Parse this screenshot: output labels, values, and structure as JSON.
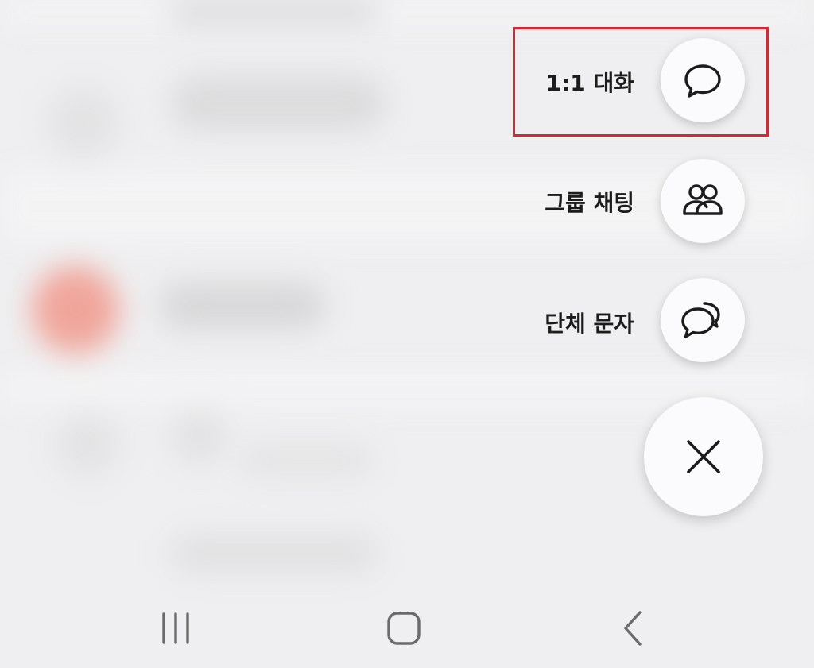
{
  "fab_menu": {
    "items": [
      {
        "label": "1:1 대화",
        "icon": "chat-bubble-icon"
      },
      {
        "label": "그룹 채팅",
        "icon": "people-icon"
      },
      {
        "label": "단체 문자",
        "icon": "chat-bubbles-icon"
      }
    ],
    "close_icon": "close-icon",
    "highlight_color": "#d9262f"
  },
  "navbar": {
    "recents_icon": "recents-icon",
    "home_icon": "home-icon",
    "back_icon": "back-icon"
  },
  "colors": {
    "background": "#efeff1",
    "fab_background": "#fbfbfd",
    "label_text": "#1c1c1c",
    "blurred_avatar": "#f0a59a"
  }
}
